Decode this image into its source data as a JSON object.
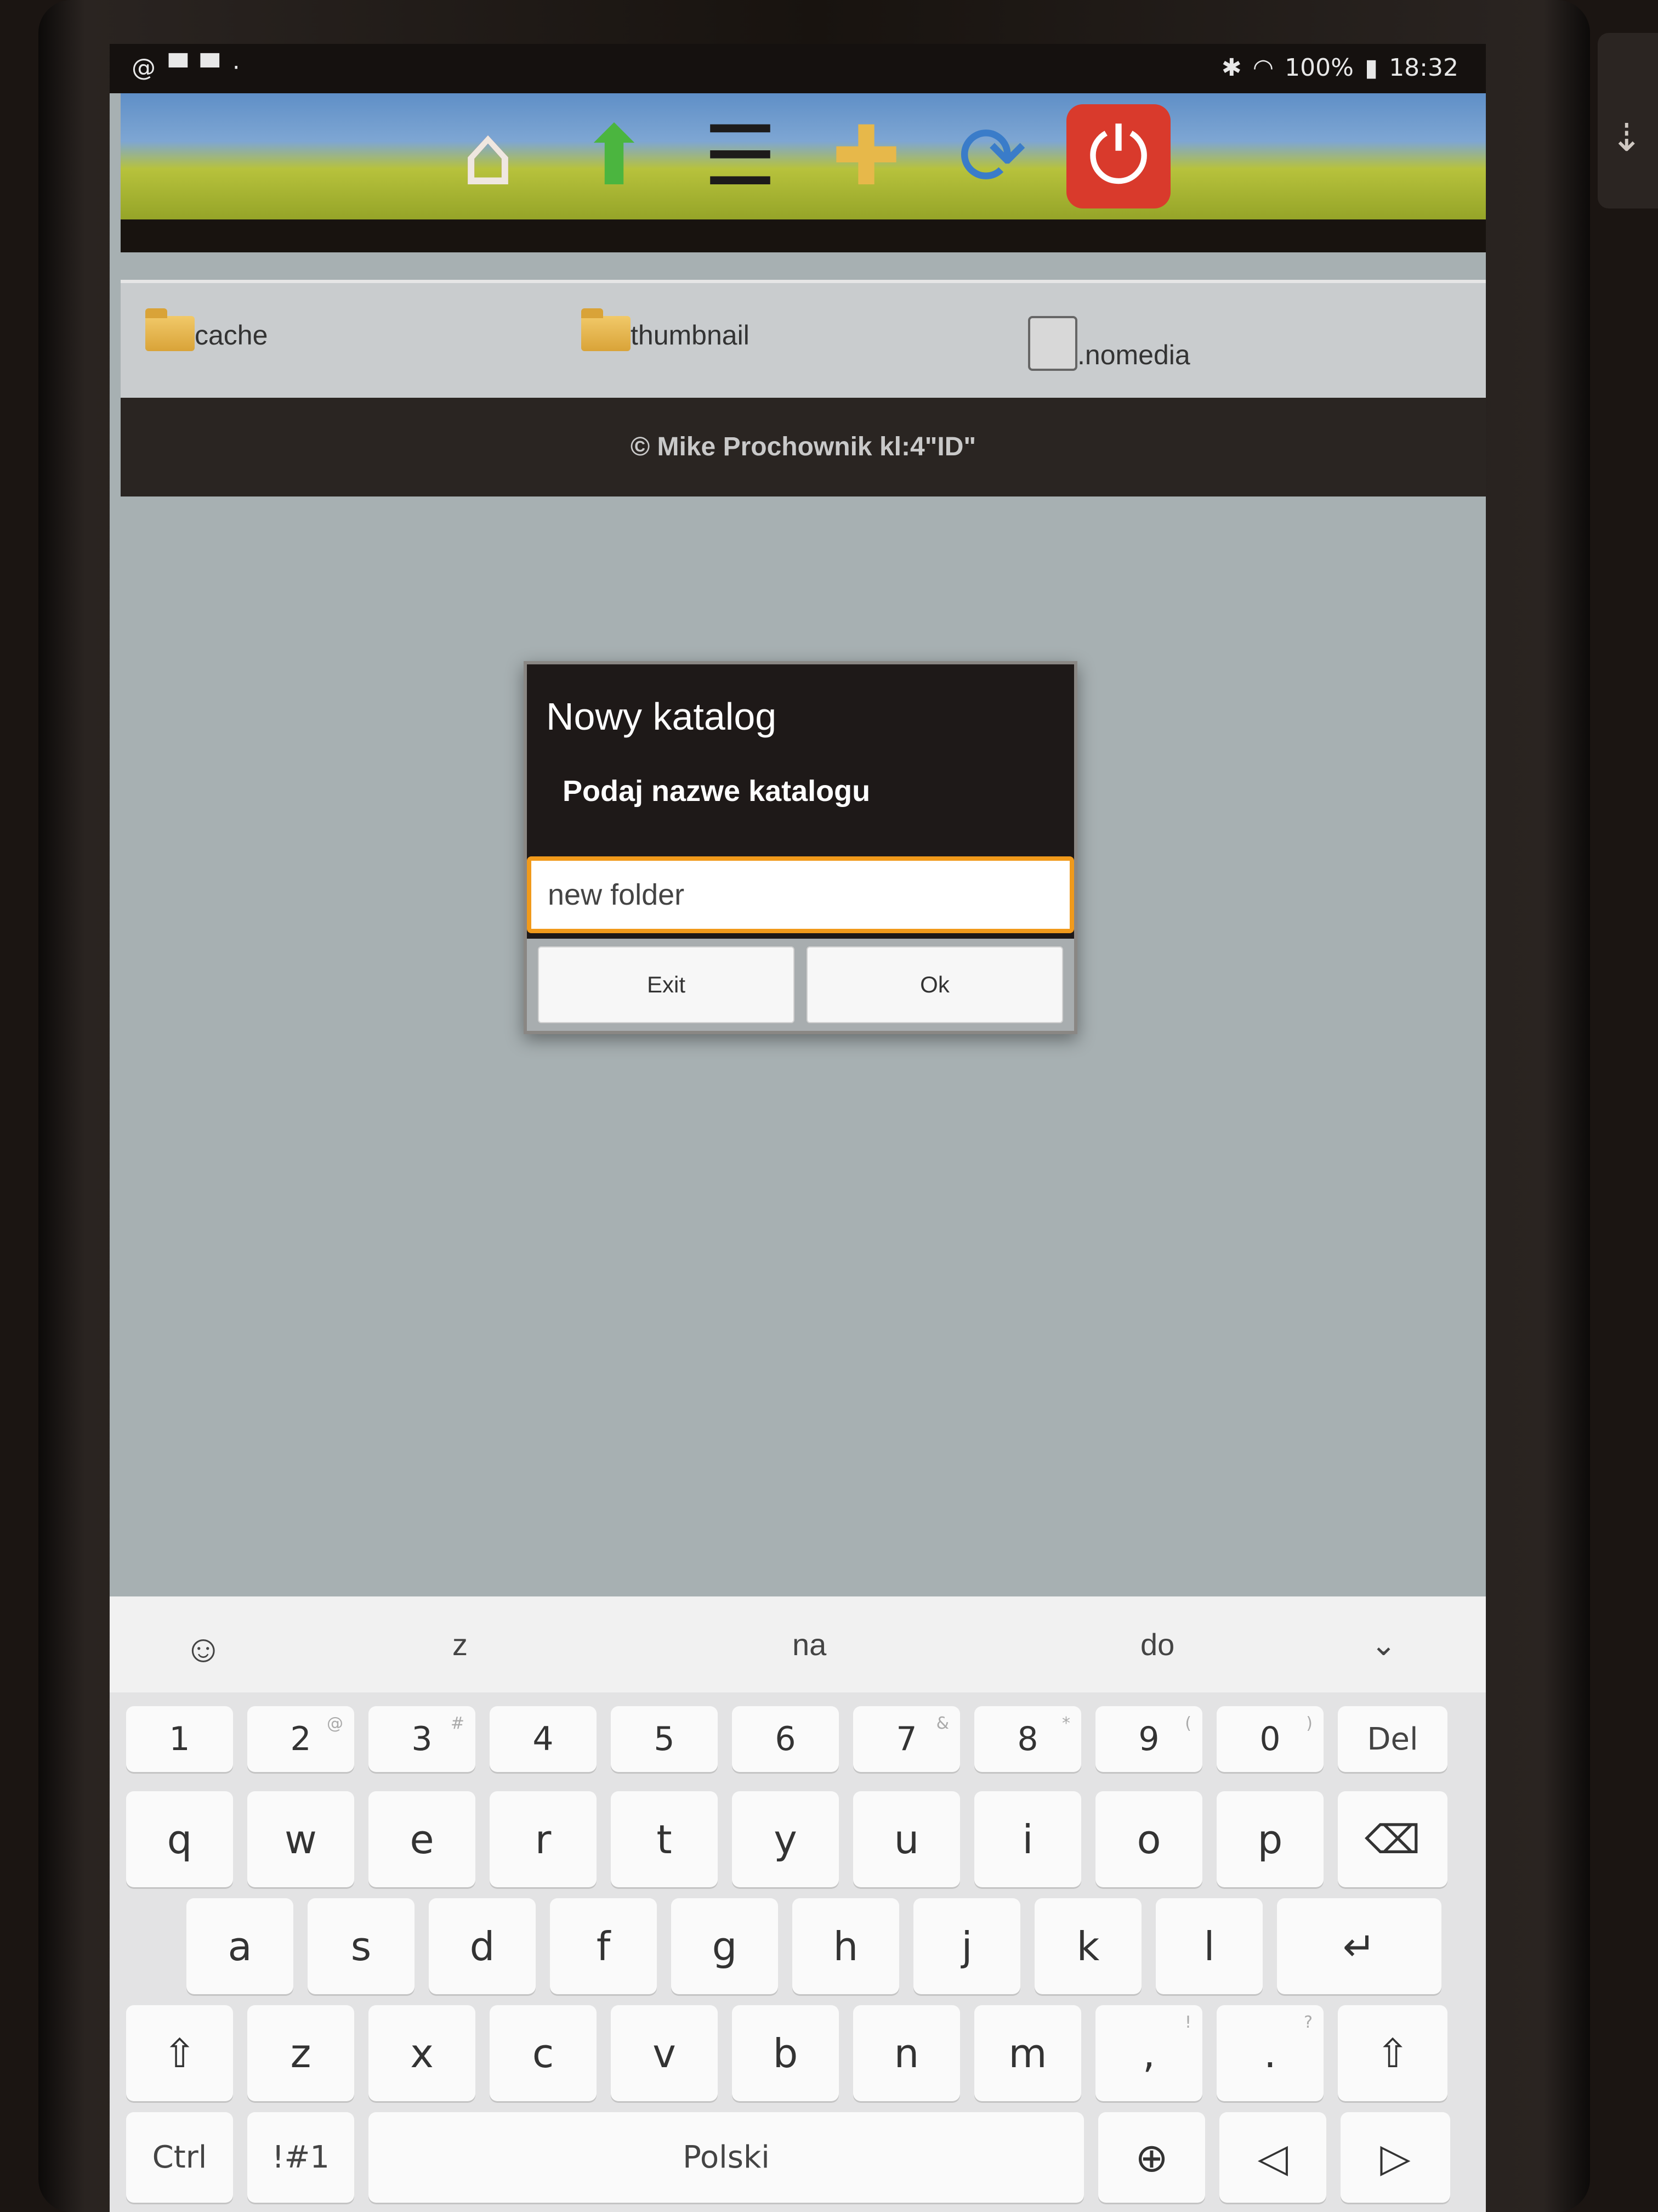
{
  "status": {
    "battery": "100%",
    "time": "18:32"
  },
  "toolbar": {
    "home_icon": "home-icon",
    "up_icon": "up-arrow-icon",
    "settings_icon": "sliders-icon",
    "newfolder_icon": "new-folder-icon",
    "refresh_icon": "refresh-icon",
    "power_icon": "power-icon"
  },
  "files": [
    {
      "name": "cache",
      "type": "folder"
    },
    {
      "name": "thumbnail",
      "type": "folder"
    },
    {
      "name": ".nomedia",
      "type": "file"
    }
  ],
  "footer": {
    "text": "© Mike Prochownik kl:4\"ID\""
  },
  "dialog": {
    "title": "Nowy katalog",
    "message": "Podaj nazwe katalogu",
    "input_value": "new folder",
    "exit_label": "Exit",
    "ok_label": "Ok"
  },
  "keyboard": {
    "suggestions": [
      "z",
      "na",
      "do"
    ],
    "number_row": [
      "1",
      "2",
      "3",
      "4",
      "5",
      "6",
      "7",
      "8",
      "9",
      "0"
    ],
    "number_hints": [
      "",
      "@",
      "#",
      "",
      "",
      "",
      "&",
      "*",
      "(",
      ")"
    ],
    "del_label": "Del",
    "row1": [
      "q",
      "w",
      "e",
      "r",
      "t",
      "y",
      "u",
      "i",
      "o",
      "p"
    ],
    "row2": [
      "a",
      "s",
      "d",
      "f",
      "g",
      "h",
      "j",
      "k",
      "l"
    ],
    "row3": [
      "z",
      "x",
      "c",
      "v",
      "b",
      "n",
      "m"
    ],
    "comma_label": ",",
    "comma_hint": "!",
    "period_label": ".",
    "period_hint": "?",
    "ctrl_label": "Ctrl",
    "symbols_label": "!#1",
    "space_label": "Polski"
  },
  "colors": {
    "dialog_input_border": "#f19a1b",
    "power_button": "#d93a2c",
    "toolbar_green": "#95a428"
  }
}
